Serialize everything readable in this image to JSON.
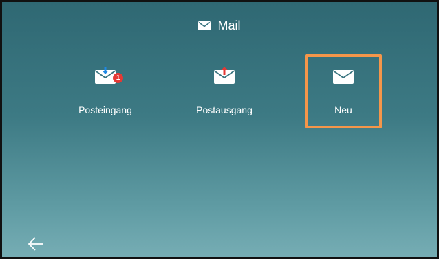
{
  "header": {
    "title": "Mail",
    "icon": "envelope-icon"
  },
  "tiles": [
    {
      "label": "Posteingang",
      "icon": "inbox-envelope-icon",
      "badge": "1",
      "arrow_color": "#1e88e5"
    },
    {
      "label": "Postausgang",
      "icon": "outbox-envelope-icon",
      "arrow_color": "#e53935"
    },
    {
      "label": "Neu",
      "icon": "new-mail-envelope-icon",
      "selected": true
    }
  ],
  "navigation": {
    "back_icon": "back-arrow-icon"
  },
  "colors": {
    "selection_border": "#f5964a",
    "badge": "#e53935",
    "background_top": "#2f6873",
    "background_bottom": "#76adb4"
  }
}
